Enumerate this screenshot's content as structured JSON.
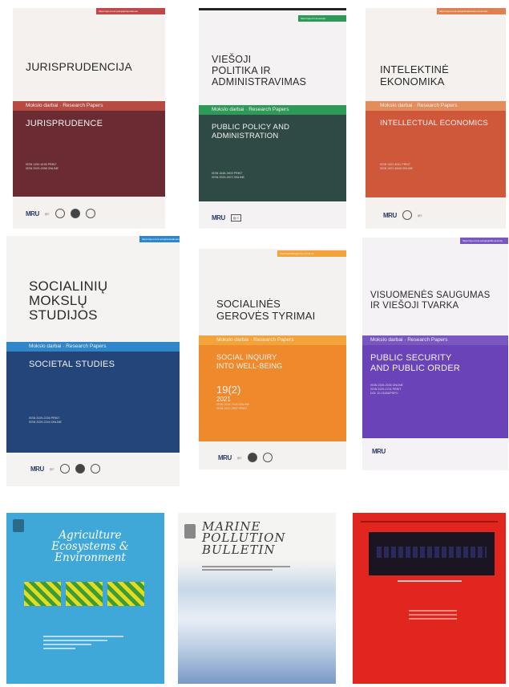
{
  "covers": {
    "jurisprudencija": {
      "url": "https://ojs.mruni.eu/ojs/jurisprudence",
      "title": "JURISPRUDENCIJA",
      "strip": "Mokslo darbai · Research Papers",
      "en_title": "JURISPRUDENCE",
      "issn1": "ISSN 1392-6195 PRINT",
      "issn2": "ISSN 2029-2058 ONLINE",
      "accent": "#b84a44",
      "panel": "#6a2b33"
    },
    "viesoji": {
      "url": "https://ojs.mruni.eu/ojs/",
      "title_lines": [
        "VIEŠOJI",
        "POLITIKA IR",
        "ADMINISTRAVIMAS"
      ],
      "strip": "Mokslo darbai · Research Papers",
      "en_title_lines": [
        "PUBLIC POLICY AND",
        "ADMINISTRATION"
      ],
      "issn1": "ISSN 1648-2603 PRINT",
      "issn2": "ISSN 2029-2872 ONLINE",
      "accent": "#2e9a58",
      "panel": "#2f4a44"
    },
    "intelektine": {
      "url": "https://ojs.mruni.eu/ojs/intellectual-economics",
      "title_lines": [
        "INTELEKTINĖ",
        "EKONOMIKA"
      ],
      "strip": "Mokslo darbai · Research Papers",
      "en_title": "INTELLECTUAL ECONOMICS",
      "issn1": "ISSN 1822-8011 PRINT",
      "issn2": "ISSN 1822-8038 ONLINE",
      "accent": "#e38c5c",
      "panel": "#d0583a"
    },
    "socialiniu": {
      "url": "https://ojs.mruni.eu/ojs/societal-studies",
      "title_lines": [
        "SOCIALINIŲ",
        "MOKSLŲ",
        "STUDIJOS"
      ],
      "strip": "Mokslo darbai · Research Papers",
      "en_title": "SOCIETAL STUDIES",
      "issn1": "ISSN 2029-2236 PRINT",
      "issn2": "ISSN 2029-2244 ONLINE",
      "accent": "#2f86c8",
      "panel": "#24457a"
    },
    "socialines": {
      "url": "https://socialinegerove.mruni.eu",
      "title_lines": [
        "SOCIALINĖS",
        "GEROVĖS TYRIMAI"
      ],
      "strip": "Mokslo darbai · Research Papers",
      "en_title_lines": [
        "SOCIAL INQUIRY",
        "INTO WELL-BEING"
      ],
      "issue": "19(2)",
      "year": "2021",
      "issn1": "ISSN 2029-7424 ONLINE",
      "issn2": "ISSN 1822-2552 PRINT",
      "accent": "#f2a43a",
      "panel": "#ef8a2c"
    },
    "visuomenes": {
      "url": "https://ojs.mruni.eu/ojs/public-security",
      "title_lines": [
        "VISUOMENĖS SAUGUMAS",
        "IR VIEŠOJI TVARKA"
      ],
      "strip": "Mokslo darbai · Research Papers",
      "en_title_lines": [
        "PUBLIC SECURITY",
        "AND PUBLIC ORDER"
      ],
      "issn1": "ISSN 2335-2035 ONLINE",
      "issn2": "ISSN 2029-1701 PRINT",
      "issn3": "DOI: 10.13165/PSPO",
      "accent": "#7a56c0",
      "panel": "#6a43b8"
    },
    "agriculture": {
      "title_lines": [
        "Agriculture",
        "Ecosystems &",
        "Environment"
      ],
      "bg": "#3fa8d8"
    },
    "marine": {
      "title_lines": [
        "MARINE",
        "POLLUTION",
        "BULLETIN"
      ],
      "bg": "#dfe8f2"
    },
    "red_journal": {
      "bg": "#e0261e"
    }
  }
}
